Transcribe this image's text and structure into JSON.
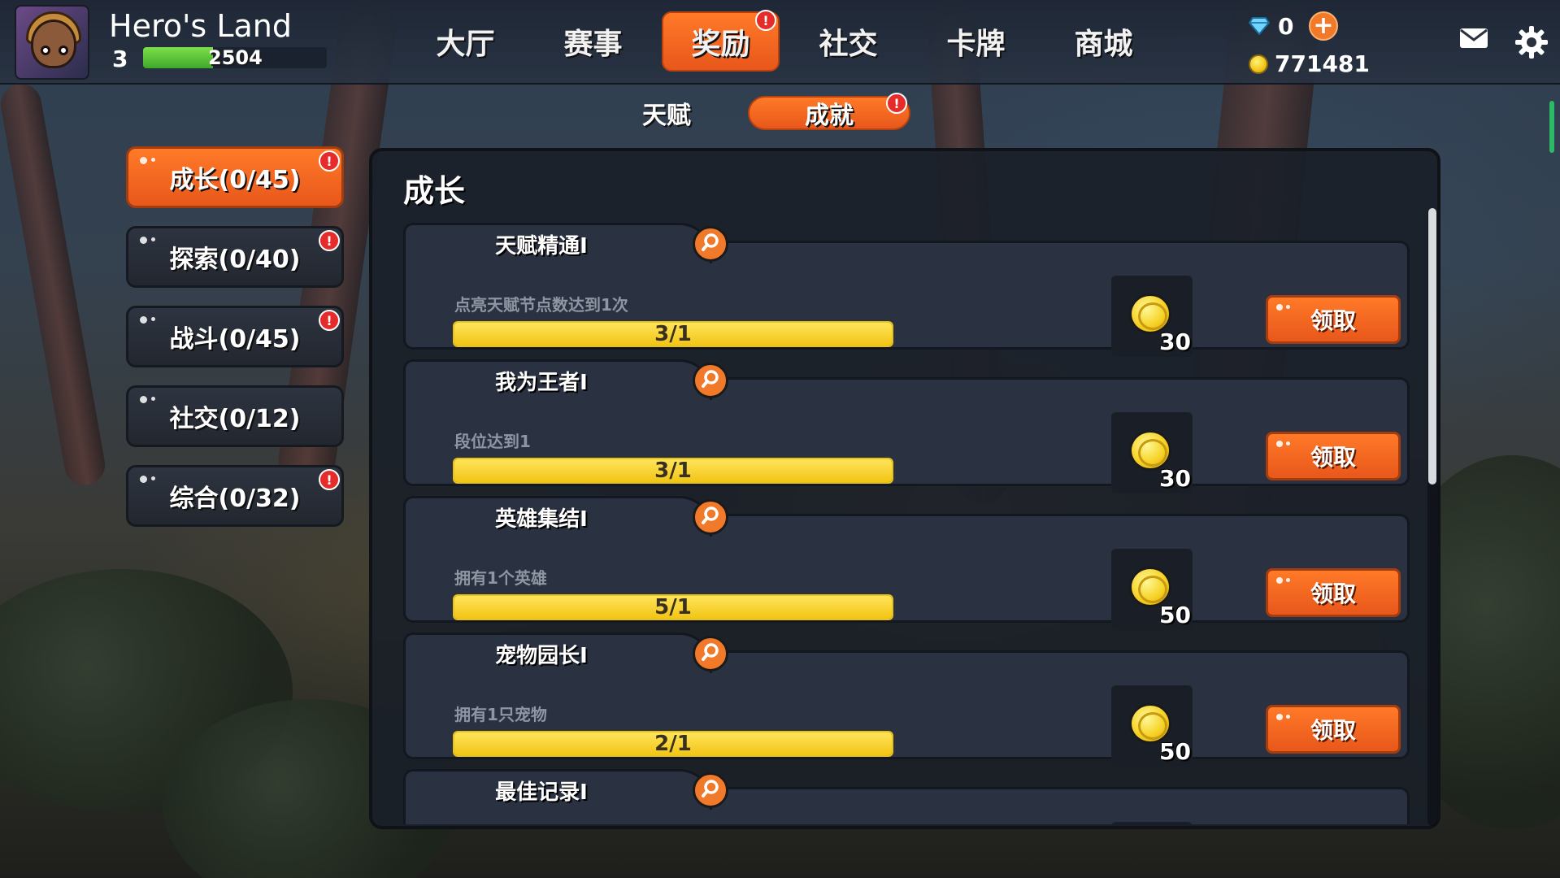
{
  "game": {
    "title": "Hero's Land",
    "level": "3",
    "xp_value": "2504",
    "xp_fraction": 0.38
  },
  "nav": {
    "items": [
      {
        "label": "大厅"
      },
      {
        "label": "赛事"
      },
      {
        "label": "奖励"
      },
      {
        "label": "社交"
      },
      {
        "label": "卡牌"
      },
      {
        "label": "商城"
      }
    ],
    "active_index": 2,
    "badge_text": "!"
  },
  "currency": {
    "gems": "0",
    "coins": "771481",
    "plus": "+"
  },
  "subtabs": [
    {
      "label": "天赋"
    },
    {
      "label": "成就"
    }
  ],
  "categories": [
    {
      "label": "成长(0/45)"
    },
    {
      "label": "探索(0/40)"
    },
    {
      "label": "战斗(0/45)"
    },
    {
      "label": "社交(0/12)"
    },
    {
      "label": "综合(0/32)"
    }
  ],
  "panel": {
    "title": "成长"
  },
  "achievements": [
    {
      "name": "天赋精通Ⅰ",
      "desc": "点亮天赋节点数达到1次",
      "progress": "3/1",
      "fill": 1.0,
      "reward": "30",
      "button": "领取"
    },
    {
      "name": "我为王者Ⅰ",
      "desc": "段位达到1",
      "progress": "3/1",
      "fill": 1.0,
      "reward": "30",
      "button": "领取"
    },
    {
      "name": "英雄集结Ⅰ",
      "desc": "拥有1个英雄",
      "progress": "5/1",
      "fill": 1.0,
      "reward": "50",
      "button": "领取"
    },
    {
      "name": "宠物园长Ⅰ",
      "desc": "拥有1只宠物",
      "progress": "2/1",
      "fill": 1.0,
      "reward": "50",
      "button": "领取"
    },
    {
      "name": "最佳记录Ⅰ",
      "desc": "",
      "progress": "",
      "fill": 1.0,
      "reward": "",
      "button": ""
    }
  ],
  "colors": {
    "accent": "#f07a2a",
    "progress": "#f2c515",
    "badge": "#e62b2b"
  },
  "icons": {
    "gem": "diamond-icon",
    "coin": "coin-icon",
    "mail": "mail-icon",
    "settings": "gear-icon",
    "search": "magnifier-icon"
  }
}
